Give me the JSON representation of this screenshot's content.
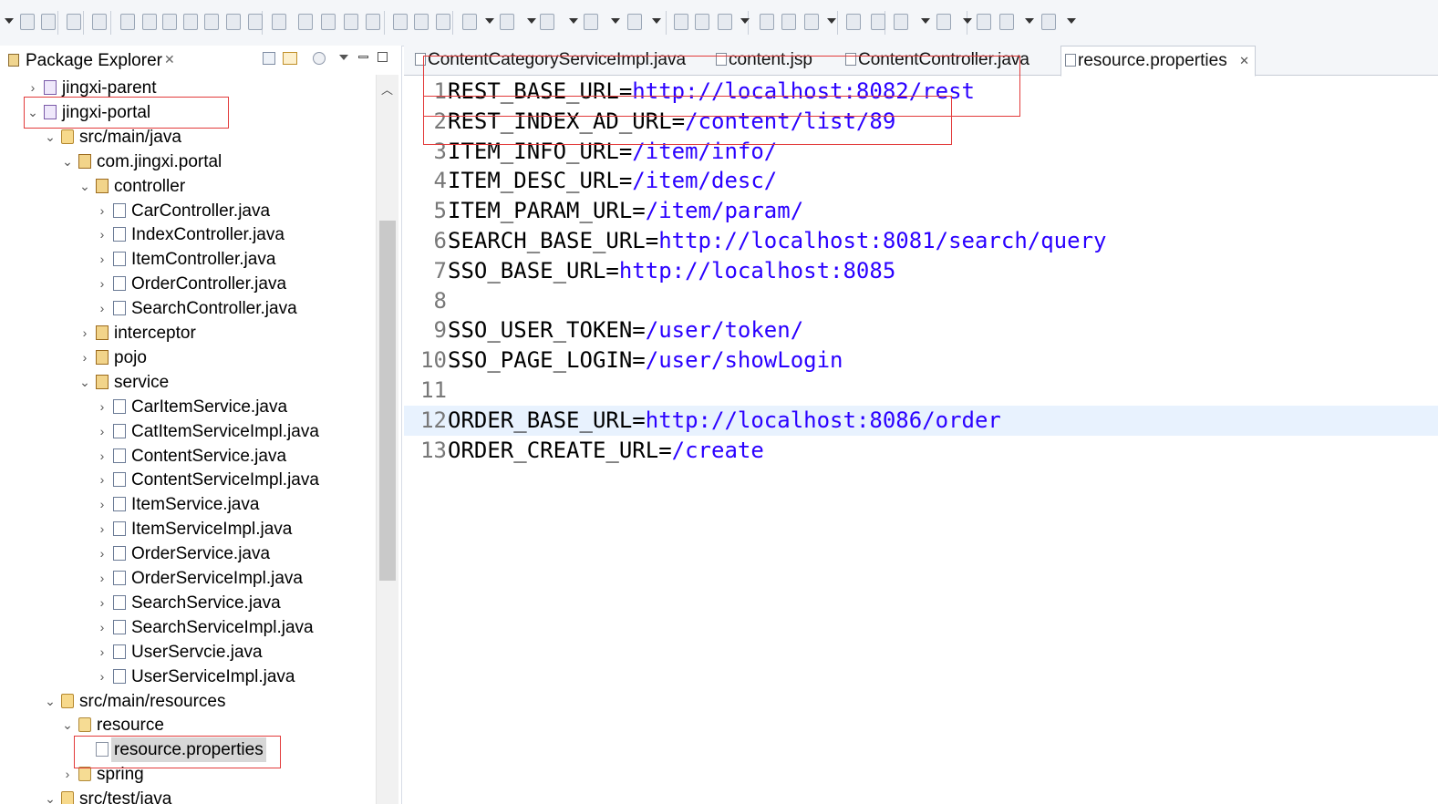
{
  "toolbar": {
    "icons": [
      "save-icon",
      "save-all-icon",
      "print-icon",
      "terminate-icon",
      "step-icon",
      "suspend-icon",
      "stop-icon",
      "disconnect-icon",
      "step-into-icon",
      "step-over-icon",
      "step-return-icon",
      "drop-frame-icon",
      "use-filters-icon",
      "toggle-breakpoint-icon",
      "server-icon",
      "mark-occurrences-icon",
      "word-wrap-icon",
      "block-selection-icon",
      "whitespace-icon",
      "debug-icon",
      "run-icon",
      "run-ext-icon",
      "stop-server-icon",
      "publish-icon",
      "new-java-project-icon",
      "new-package-icon",
      "new-class-icon",
      "open-type-icon",
      "open-task-icon",
      "search-icon",
      "open-perspective-icon",
      "globe-icon",
      "next-annotation-icon",
      "previous-annotation-icon",
      "last-edit-icon",
      "back-icon",
      "forward-icon"
    ]
  },
  "package_explorer": {
    "title": "Package Explorer",
    "items": [
      {
        "label": "jingxi-parent",
        "level": 0,
        "state": "collapsed",
        "icon": "project-icon"
      },
      {
        "label": "jingxi-portal",
        "level": 0,
        "state": "expanded",
        "icon": "project-icon"
      },
      {
        "label": "src/main/java",
        "level": 1,
        "state": "expanded",
        "icon": "source-folder-icon"
      },
      {
        "label": "com.jingxi.portal",
        "level": 2,
        "state": "expanded",
        "icon": "package-icon"
      },
      {
        "label": "controller",
        "level": 3,
        "state": "expanded",
        "icon": "package-icon"
      },
      {
        "label": "CarController.java",
        "level": 4,
        "state": "collapsed",
        "icon": "java-file-icon"
      },
      {
        "label": "IndexController.java",
        "level": 4,
        "state": "collapsed",
        "icon": "java-file-icon"
      },
      {
        "label": "ItemController.java",
        "level": 4,
        "state": "collapsed",
        "icon": "java-file-icon"
      },
      {
        "label": "OrderController.java",
        "level": 4,
        "state": "collapsed",
        "icon": "java-file-icon"
      },
      {
        "label": "SearchController.java",
        "level": 4,
        "state": "collapsed",
        "icon": "java-file-icon"
      },
      {
        "label": "interceptor",
        "level": 3,
        "state": "collapsed",
        "icon": "package-icon"
      },
      {
        "label": "pojo",
        "level": 3,
        "state": "collapsed",
        "icon": "package-icon"
      },
      {
        "label": "service",
        "level": 3,
        "state": "expanded",
        "icon": "package-icon"
      },
      {
        "label": "CarItemService.java",
        "level": 4,
        "state": "collapsed",
        "icon": "java-file-icon"
      },
      {
        "label": "CatItemServiceImpl.java",
        "level": 4,
        "state": "collapsed",
        "icon": "java-file-icon"
      },
      {
        "label": "ContentService.java",
        "level": 4,
        "state": "collapsed",
        "icon": "java-file-icon"
      },
      {
        "label": "ContentServiceImpl.java",
        "level": 4,
        "state": "collapsed",
        "icon": "java-file-icon"
      },
      {
        "label": "ItemService.java",
        "level": 4,
        "state": "collapsed",
        "icon": "java-file-icon"
      },
      {
        "label": "ItemServiceImpl.java",
        "level": 4,
        "state": "collapsed",
        "icon": "java-file-icon"
      },
      {
        "label": "OrderService.java",
        "level": 4,
        "state": "collapsed",
        "icon": "java-file-icon"
      },
      {
        "label": "OrderServiceImpl.java",
        "level": 4,
        "state": "collapsed",
        "icon": "java-file-icon"
      },
      {
        "label": "SearchService.java",
        "level": 4,
        "state": "collapsed",
        "icon": "java-file-icon"
      },
      {
        "label": "SearchServiceImpl.java",
        "level": 4,
        "state": "collapsed",
        "icon": "java-file-icon"
      },
      {
        "label": "UserServcie.java",
        "level": 4,
        "state": "collapsed",
        "icon": "java-file-icon"
      },
      {
        "label": "UserServiceImpl.java",
        "level": 4,
        "state": "collapsed",
        "icon": "java-file-icon"
      },
      {
        "label": "src/main/resources",
        "level": 1,
        "state": "expanded",
        "icon": "source-folder-icon"
      },
      {
        "label": "resource",
        "level": 2,
        "state": "expanded",
        "icon": "folder-icon"
      },
      {
        "label": "resource.properties",
        "level": 3,
        "state": "leaf",
        "icon": "properties-file-icon",
        "selected": true
      },
      {
        "label": "spring",
        "level": 2,
        "state": "collapsed",
        "icon": "folder-icon"
      },
      {
        "label": "src/test/java",
        "level": 1,
        "state": "expanded",
        "icon": "source-folder-icon"
      }
    ]
  },
  "editor": {
    "tabs": [
      {
        "label": "ContentCategoryServiceImpl.java",
        "active": false
      },
      {
        "label": "content.jsp",
        "active": false
      },
      {
        "label": "ContentController.java",
        "active": false
      },
      {
        "label": "resource.properties",
        "active": true
      }
    ],
    "lines": [
      {
        "num": "1",
        "key": "REST_BASE_URL=",
        "value": "http://localhost:8082/rest"
      },
      {
        "num": "2",
        "key": "REST_INDEX_AD_URL=",
        "value": "/content/list/89"
      },
      {
        "num": "3",
        "key": "ITEM_INFO_URL=",
        "value": "/item/info/"
      },
      {
        "num": "4",
        "key": "ITEM_DESC_URL=",
        "value": "/item/desc/"
      },
      {
        "num": "5",
        "key": "ITEM_PARAM_URL=",
        "value": "/item/param/"
      },
      {
        "num": "6",
        "key": "SEARCH_BASE_URL=",
        "value": "http://localhost:8081/search/query"
      },
      {
        "num": "7",
        "key": "SSO_BASE_URL=",
        "value": "http://localhost:8085"
      },
      {
        "num": "8",
        "key": "",
        "value": ""
      },
      {
        "num": "9",
        "key": "SSO_USER_TOKEN=",
        "value": "/user/token/"
      },
      {
        "num": "10",
        "key": "SSO_PAGE_LOGIN=",
        "value": "/user/showLogin"
      },
      {
        "num": "11",
        "key": "",
        "value": ""
      },
      {
        "num": "12",
        "key": "ORDER_BASE_URL=",
        "value": "http://localhost:8086/order",
        "current": true
      },
      {
        "num": "13",
        "key": "ORDER_CREATE_URL=",
        "value": "/create"
      }
    ],
    "colors": {
      "key": "#000000",
      "value": "#2a00ff",
      "line_number": "#787878",
      "current_line": "#e8f2fe"
    }
  },
  "annotations": {
    "highlight_color": "#e23b3b"
  }
}
